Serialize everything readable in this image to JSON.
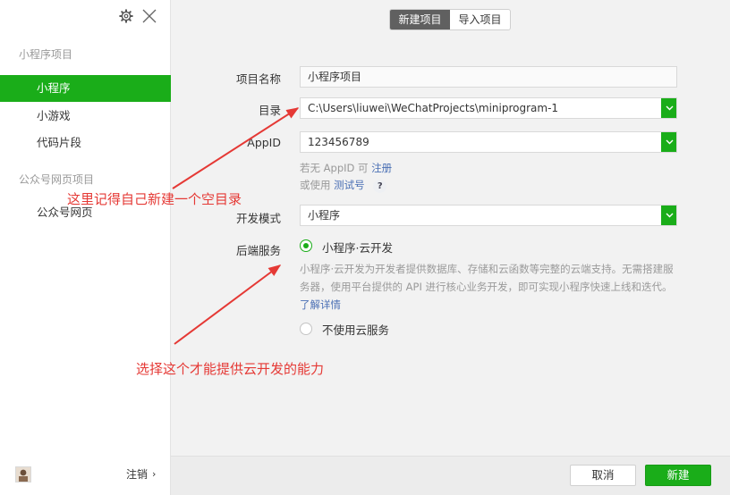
{
  "sidebar": {
    "group_miniprogram": "小程序项目",
    "items_mp": [
      {
        "label": "小程序",
        "active": true
      },
      {
        "label": "小游戏",
        "active": false
      },
      {
        "label": "代码片段",
        "active": false
      }
    ],
    "group_official": "公众号网页项目",
    "items_official": [
      {
        "label": "公众号网页",
        "active": false
      }
    ],
    "logout_label": "注销"
  },
  "icons": {
    "settings": "gear-icon",
    "close": "close-icon",
    "dropdown": "chevron-down-icon",
    "logout": "chevron-right-icon"
  },
  "tabs": [
    {
      "label": "新建项目",
      "active": true
    },
    {
      "label": "导入项目",
      "active": false
    }
  ],
  "form": {
    "project_name_label": "项目名称",
    "project_name_value": "小程序项目",
    "dir_label": "目录",
    "dir_value": "C:\\Users\\liuwei\\WeChatProjects\\miniprogram-1",
    "appid_label": "AppID",
    "appid_value": "123456789",
    "appid_hint_prefix": "若无 AppID 可",
    "appid_hint_link": "注册",
    "test_hint_prefix": "或使用",
    "test_hint_link": "测试号",
    "help_symbol": "?",
    "dev_mode_label": "开发模式",
    "dev_mode_value": "小程序",
    "backend_label": "后端服务",
    "backend_option_cloud": "小程序·云开发",
    "backend_cloud_desc": "小程序·云开发为开发者提供数据库、存储和云函数等完整的云端支持。无需搭建服务器，使用平台提供的 API 进行核心业务开发，即可实现小程序快速上线和迭代。",
    "backend_cloud_link": "了解详情",
    "backend_option_none": "不使用云服务"
  },
  "footer": {
    "cancel_label": "取消",
    "create_label": "新建"
  },
  "annotations": {
    "dir_note": "这里记得自己新建一个空目录",
    "cloud_note": "选择这个才能提供云开发的能力"
  },
  "colors": {
    "accent": "#1aad19",
    "annotation": "#e53935",
    "link": "#4a6fb4"
  }
}
